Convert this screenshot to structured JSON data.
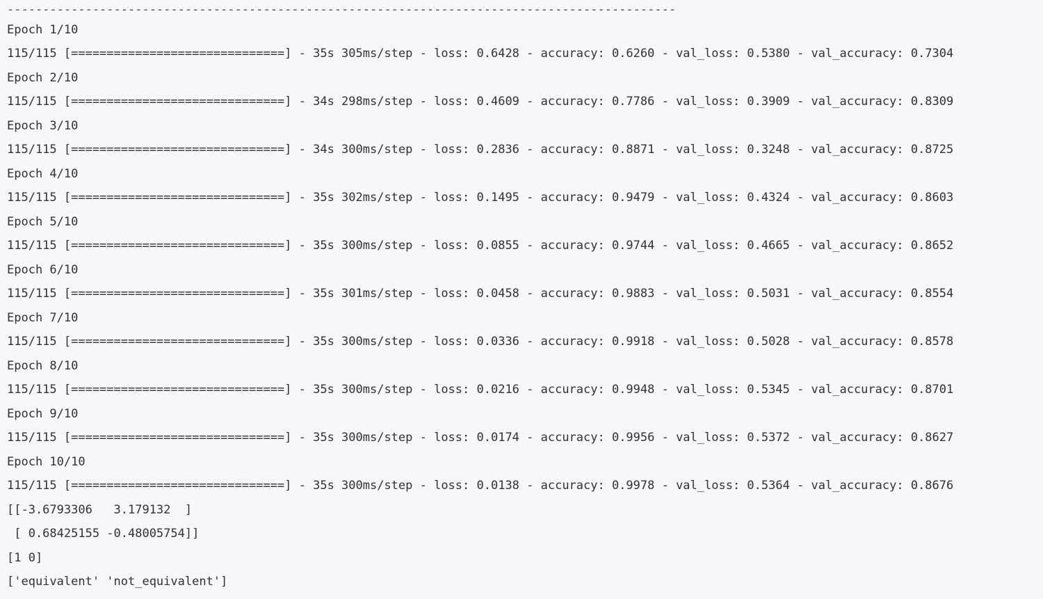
{
  "console": {
    "separator": "----------------------------------------------------------------------------------------------",
    "epochs": [
      {
        "label": "Epoch 1/10",
        "progress": "115/115 [==============================] - 35s 305ms/step - loss: 0.6428 - accuracy: 0.6260 - val_loss: 0.5380 - val_accuracy: 0.7304"
      },
      {
        "label": "Epoch 2/10",
        "progress": "115/115 [==============================] - 34s 298ms/step - loss: 0.4609 - accuracy: 0.7786 - val_loss: 0.3909 - val_accuracy: 0.8309"
      },
      {
        "label": "Epoch 3/10",
        "progress": "115/115 [==============================] - 34s 300ms/step - loss: 0.2836 - accuracy: 0.8871 - val_loss: 0.3248 - val_accuracy: 0.8725"
      },
      {
        "label": "Epoch 4/10",
        "progress": "115/115 [==============================] - 35s 302ms/step - loss: 0.1495 - accuracy: 0.9479 - val_loss: 0.4324 - val_accuracy: 0.8603"
      },
      {
        "label": "Epoch 5/10",
        "progress": "115/115 [==============================] - 35s 300ms/step - loss: 0.0855 - accuracy: 0.9744 - val_loss: 0.4665 - val_accuracy: 0.8652"
      },
      {
        "label": "Epoch 6/10",
        "progress": "115/115 [==============================] - 35s 301ms/step - loss: 0.0458 - accuracy: 0.9883 - val_loss: 0.5031 - val_accuracy: 0.8554"
      },
      {
        "label": "Epoch 7/10",
        "progress": "115/115 [==============================] - 35s 300ms/step - loss: 0.0336 - accuracy: 0.9918 - val_loss: 0.5028 - val_accuracy: 0.8578"
      },
      {
        "label": "Epoch 8/10",
        "progress": "115/115 [==============================] - 35s 300ms/step - loss: 0.0216 - accuracy: 0.9948 - val_loss: 0.5345 - val_accuracy: 0.8701"
      },
      {
        "label": "Epoch 9/10",
        "progress": "115/115 [==============================] - 35s 300ms/step - loss: 0.0174 - accuracy: 0.9956 - val_loss: 0.5372 - val_accuracy: 0.8627"
      },
      {
        "label": "Epoch 10/10",
        "progress": "115/115 [==============================] - 35s 300ms/step - loss: 0.0138 - accuracy: 0.9978 - val_loss: 0.5364 - val_accuracy: 0.8676"
      }
    ],
    "output_lines": [
      "[[-3.6793306   3.179132  ]",
      " [ 0.68425155 -0.48005754]]",
      "[1 0]",
      "['equivalent' 'not_equivalent']"
    ]
  }
}
